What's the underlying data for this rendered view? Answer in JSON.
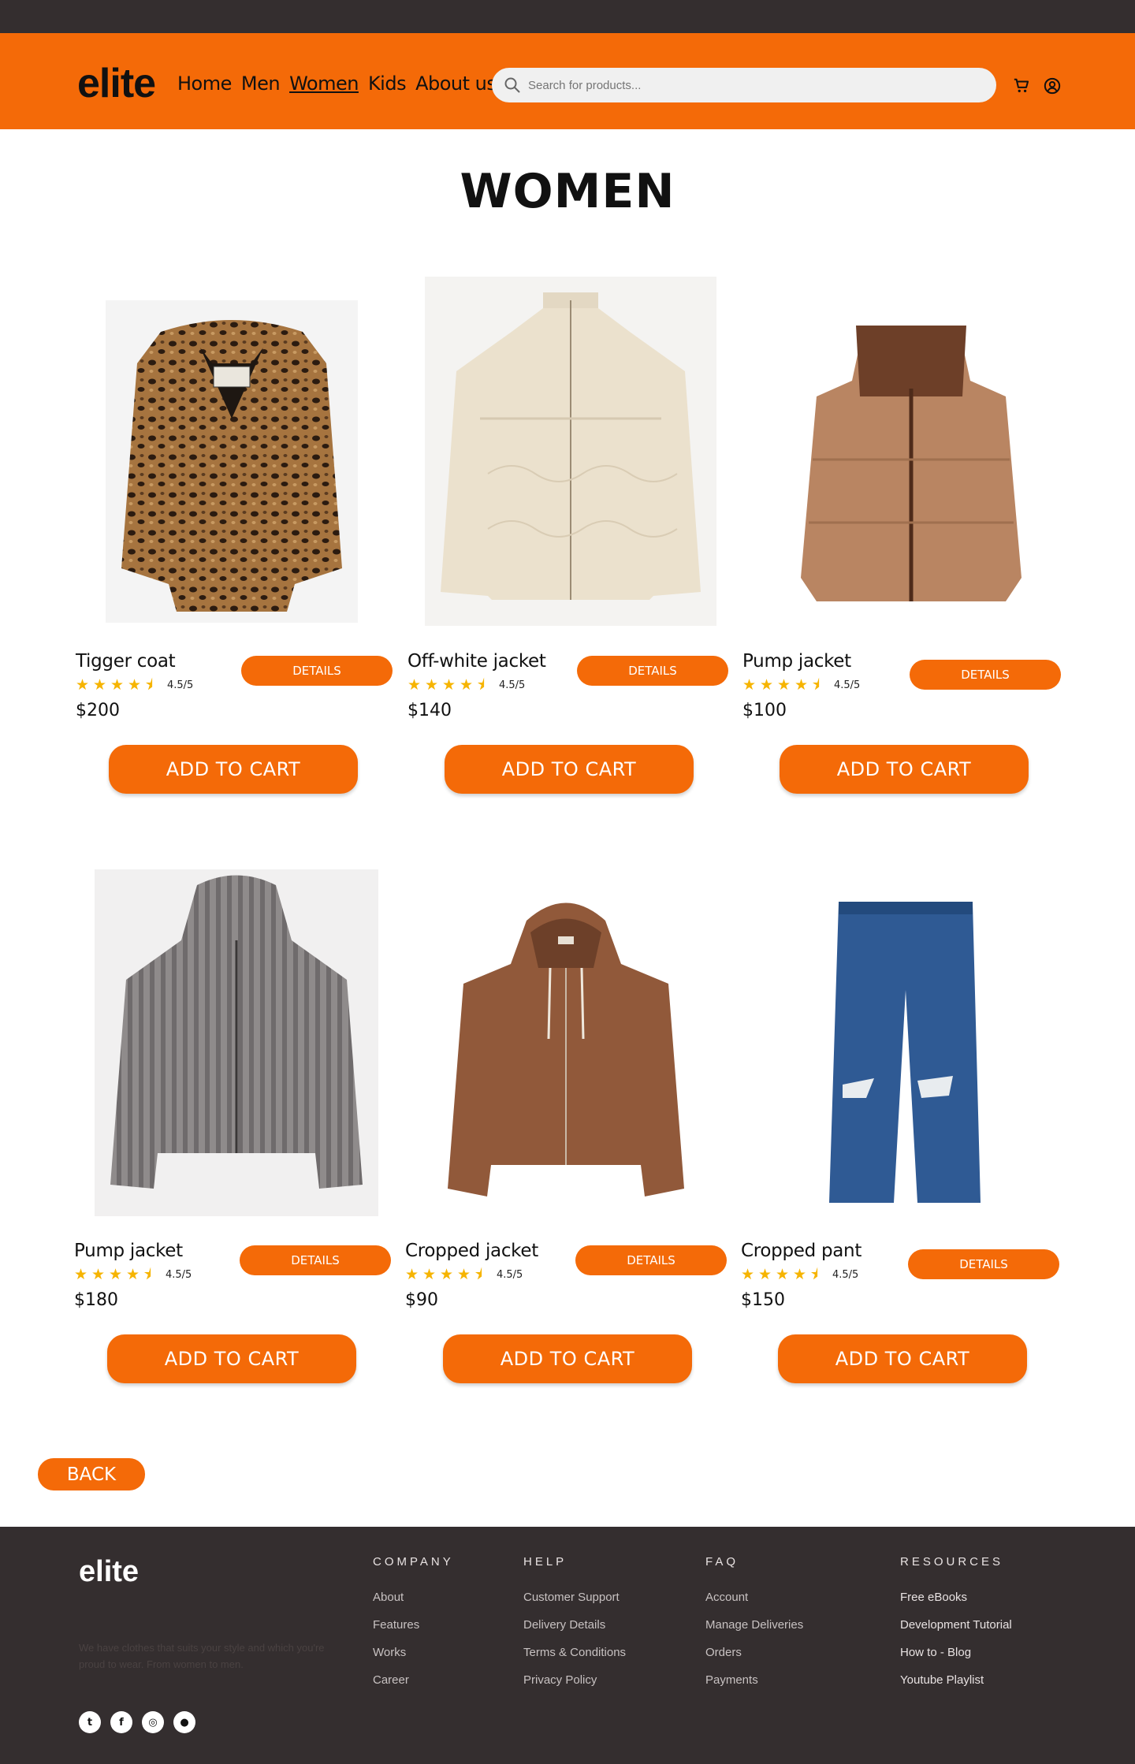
{
  "header": {
    "logo": "elite",
    "nav": [
      "Home",
      "Men",
      "Women",
      "Kids",
      "About us"
    ],
    "active_nav": "Women",
    "search_placeholder": "Search for products..."
  },
  "page": {
    "title": "WOMEN",
    "back_label": "BACK"
  },
  "buttons": {
    "details": "DETAILS",
    "add_to_cart": "ADD TO CART"
  },
  "products": [
    {
      "name": "Tigger coat",
      "rating": 4.5,
      "rating_text": "4.5/5",
      "price": "$200"
    },
    {
      "name": "Off-white jacket",
      "rating": 4.5,
      "rating_text": "4.5/5",
      "price": "$140"
    },
    {
      "name": "Pump jacket",
      "rating": 4.5,
      "rating_text": "4.5/5",
      "price": "$100"
    },
    {
      "name": "Pump jacket",
      "rating": 4.5,
      "rating_text": "4.5/5",
      "price": "$180"
    },
    {
      "name": "Cropped jacket",
      "rating": 4.5,
      "rating_text": "4.5/5",
      "price": "$90"
    },
    {
      "name": "Cropped pant",
      "rating": 4.5,
      "rating_text": "4.5/5",
      "price": "$150"
    }
  ],
  "footer": {
    "logo": "elite",
    "tagline": "We have clothes that suits your style and which you're proud to wear. From women to men.",
    "columns": [
      {
        "title": "COMPANY",
        "links": [
          "About",
          "Features",
          "Works",
          "Career"
        ]
      },
      {
        "title": "HELP",
        "links": [
          "Customer Support",
          "Delivery Details",
          "Terms & Conditions",
          "Privacy Policy"
        ]
      },
      {
        "title": "FAQ",
        "links": [
          "Account",
          "Manage Deliveries",
          "Orders",
          "Payments"
        ]
      },
      {
        "title": "RESOURCES",
        "links": [
          "Free eBooks",
          "Development Tutorial",
          "How to - Blog",
          "Youtube Playlist"
        ]
      }
    ],
    "social_icons": [
      "twitter-icon",
      "facebook-icon",
      "instagram-icon",
      "github-icon"
    ]
  },
  "colors": {
    "accent": "#f46a08",
    "dark": "#342e2f",
    "star": "#f6b400"
  }
}
